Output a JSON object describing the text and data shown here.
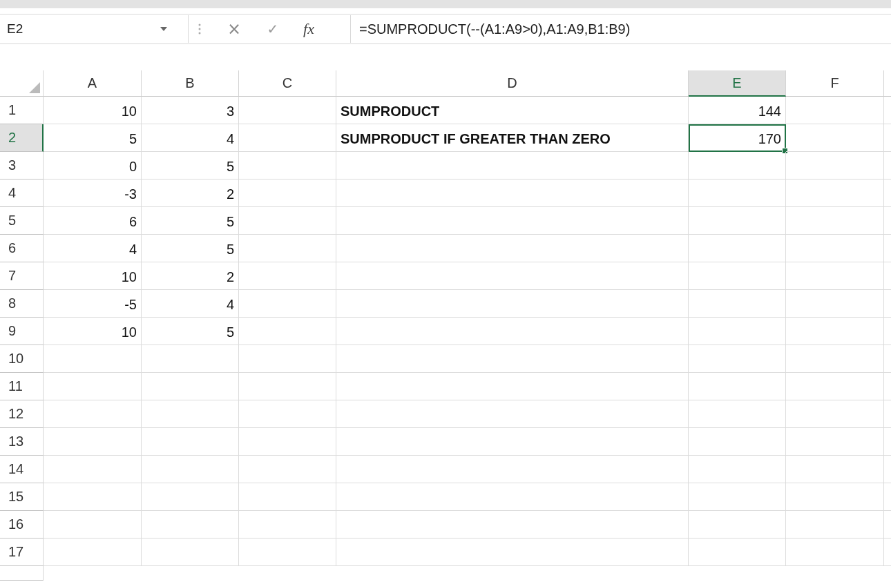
{
  "name_box": "E2",
  "formula_bar": {
    "cancel": "×",
    "enter": "✓",
    "fx": "fx",
    "formula": "=SUMPRODUCT(--(A1:A9>0),A1:A9,B1:B9)"
  },
  "columns": [
    {
      "label": "A",
      "selected": false,
      "kind": "number",
      "bold": false
    },
    {
      "label": "B",
      "selected": false,
      "kind": "number",
      "bold": false
    },
    {
      "label": "C",
      "selected": false,
      "kind": "number",
      "bold": false
    },
    {
      "label": "D",
      "selected": false,
      "kind": "text",
      "bold": true
    },
    {
      "label": "E",
      "selected": true,
      "kind": "number",
      "bold": false
    },
    {
      "label": "F",
      "selected": false,
      "kind": "number",
      "bold": false
    }
  ],
  "rows": [
    {
      "label": "1",
      "selected": false,
      "cells": {
        "a": "10",
        "b": "3",
        "d": "SUMPRODUCT",
        "e": "144"
      }
    },
    {
      "label": "2",
      "selected": true,
      "cells": {
        "a": "5",
        "b": "4",
        "d": "SUMPRODUCT IF GREATER THAN ZERO",
        "e": "170"
      }
    },
    {
      "label": "3",
      "selected": false,
      "cells": {
        "a": "0",
        "b": "5"
      }
    },
    {
      "label": "4",
      "selected": false,
      "cells": {
        "a": "-3",
        "b": "2"
      }
    },
    {
      "label": "5",
      "selected": false,
      "cells": {
        "a": "6",
        "b": "5"
      }
    },
    {
      "label": "6",
      "selected": false,
      "cells": {
        "a": "4",
        "b": "5"
      }
    },
    {
      "label": "7",
      "selected": false,
      "cells": {
        "a": "10",
        "b": "2"
      }
    },
    {
      "label": "8",
      "selected": false,
      "cells": {
        "a": "-5",
        "b": "4"
      }
    },
    {
      "label": "9",
      "selected": false,
      "cells": {
        "a": "10",
        "b": "5"
      }
    },
    {
      "label": "10",
      "selected": false,
      "cells": {}
    },
    {
      "label": "11",
      "selected": false,
      "cells": {}
    },
    {
      "label": "12",
      "selected": false,
      "cells": {}
    },
    {
      "label": "13",
      "selected": false,
      "cells": {}
    },
    {
      "label": "14",
      "selected": false,
      "cells": {}
    },
    {
      "label": "15",
      "selected": false,
      "cells": {}
    },
    {
      "label": "16",
      "selected": false,
      "cells": {}
    },
    {
      "label": "17",
      "selected": false,
      "cells": {}
    }
  ]
}
